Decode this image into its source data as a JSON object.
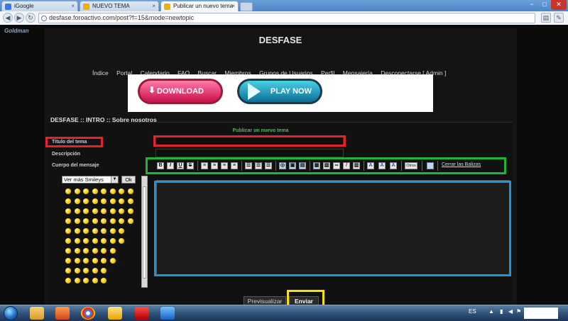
{
  "browser": {
    "tabs": [
      {
        "label": "iGoogle",
        "icon": "google-icon",
        "color": "#3b7be0"
      },
      {
        "label": "NUEVO TEMA",
        "icon": "forum-icon",
        "color": "#e8b400"
      },
      {
        "label": "Publicar un nuevo tema",
        "icon": "forum-icon",
        "color": "#e8b400"
      }
    ],
    "url": "desfase.foroactivo.com/post?f=15&mode=newtopic",
    "window_controls": [
      "−",
      "□",
      "✕"
    ]
  },
  "forum": {
    "logo_text": "Goldman",
    "site_title": "DESFASE",
    "nav": [
      "Índice",
      "Portal",
      "Calendario",
      "FAQ",
      "Buscar",
      "Miembros",
      "Grupos de Usuarios",
      "Perfil",
      "Mensajería",
      "Desconectarse [ Admin ]"
    ],
    "banner": {
      "download_label": "DOWNLOAD",
      "play_label": "PLAY NOW"
    },
    "breadcrumb": "DESFASE  :: INTRO :: Sobre nosotros",
    "form": {
      "header": "Publicar un nuevo tema",
      "title_label": "Título del tema",
      "title_value": "",
      "description_label": "Descripción",
      "description_value": "",
      "message_label": "Cuerpo del mensaje",
      "message_value": "",
      "smileys_select": "Ver más Smileys",
      "smileys_ok": "Ok",
      "toolbar_buttons": [
        "B",
        "I",
        "U",
        "S",
        "≡",
        "≡",
        "≡",
        "≡",
        "☰",
        "☰",
        "☰",
        "◎",
        "▣",
        "▤",
        "▦",
        "▧",
        "∞",
        "/",
        "▥",
        "A",
        "A",
        "A"
      ],
      "toolbar_others": "Otros",
      "toolbar_close": "Cerrar las Balizas",
      "preview_label": "Previsualizar",
      "send_label": "Enviar"
    },
    "highlight_colors": {
      "red": "#e2242b",
      "green": "#1fb33a",
      "blue": "#1f94d8",
      "yellow": "#f2e30e"
    }
  },
  "taskbar": {
    "language": "ES",
    "pinned": [
      "explorer-icon",
      "media-player-icon",
      "chrome-icon",
      "app-icon",
      "mcafee-icon",
      "ie-icon"
    ]
  }
}
